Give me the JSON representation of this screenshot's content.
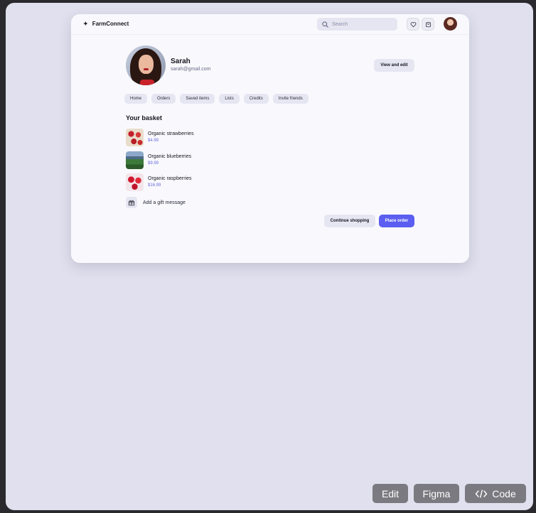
{
  "app": {
    "name": "FarmConnect"
  },
  "search": {
    "placeholder": "Search"
  },
  "profile": {
    "name": "Sarah",
    "email": "sarah@gmail.com",
    "edit_label": "View and edit"
  },
  "tabs": [
    "Home",
    "Orders",
    "Saved items",
    "Lists",
    "Credits",
    "Invite friends"
  ],
  "basket": {
    "title": "Your basket",
    "items": [
      {
        "name": "Organic strawberries",
        "price": "$4.99"
      },
      {
        "name": "Organic blueberries",
        "price": "$9.99"
      },
      {
        "name": "Organic raspberries",
        "price": "$16.99"
      }
    ],
    "gift_label": "Add a gift message"
  },
  "actions": {
    "continue_label": "Continue shopping",
    "place_label": "Place order"
  },
  "bottom_bar": {
    "edit": "Edit",
    "figma": "Figma",
    "code": "Code"
  },
  "colors": {
    "accent": "#5b5ef0",
    "price": "#6a6ae0",
    "background": "#e0e0ee",
    "card": "#f9f9fd"
  },
  "icons": {
    "brand": "sparkle-icon",
    "search": "search-icon",
    "heart": "heart-icon",
    "bag": "shopping-bag-icon",
    "gift": "gift-icon",
    "code": "code-icon"
  }
}
